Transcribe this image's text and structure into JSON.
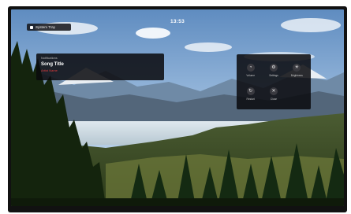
{
  "top_badge": {
    "label": "System Tray",
    "icon": "monitor-icon"
  },
  "clock": {
    "time": "13:53"
  },
  "notification": {
    "app": "Notifications",
    "title": "Song Title",
    "subtitle": "Artist Name"
  },
  "quick_panel": {
    "tiles": [
      {
        "label": "Volume",
        "icon": "volume-icon"
      },
      {
        "label": "Settings",
        "icon": "gear-icon"
      },
      {
        "label": "Brightness",
        "icon": "light-icon"
      },
      {
        "label": "Restart",
        "icon": "restart-icon"
      },
      {
        "label": "Close",
        "icon": "close-icon"
      }
    ]
  },
  "colors": {
    "sky": "#8fb6dc",
    "lake": "#cfdfe8",
    "forest": "#1f3a16",
    "accent_red": "#e03a3a"
  }
}
